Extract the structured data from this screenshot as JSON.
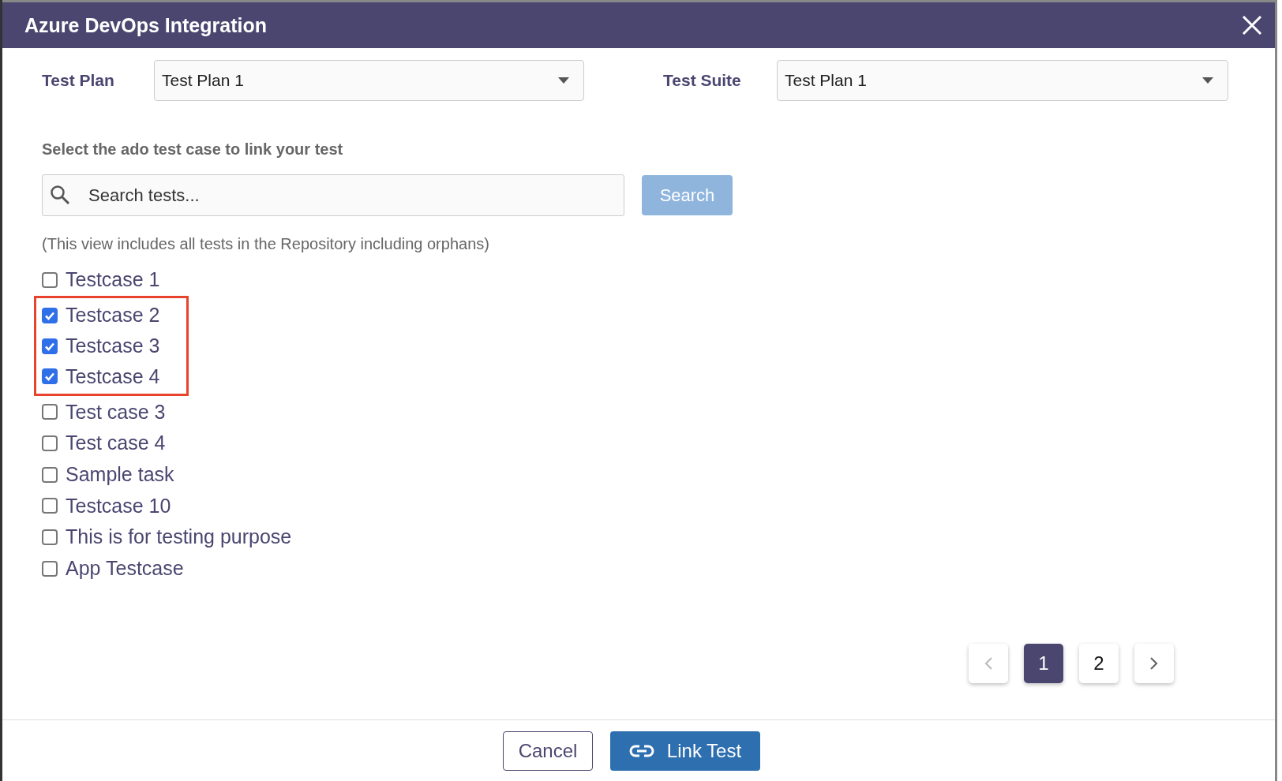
{
  "window": {
    "title": "Azure DevOps Integration"
  },
  "fields": [
    {
      "label": "Test Plan",
      "value": "Test Plan 1"
    },
    {
      "label": "Test Suite",
      "value": "Test Plan 1"
    }
  ],
  "section_title": "Select the ado test case to link your test",
  "search": {
    "placeholder": "Search tests...",
    "button": "Search",
    "disabled": true
  },
  "note": "(This view includes all tests in the Repository including orphans)",
  "test_cases": [
    {
      "label": "Testcase 1",
      "checked": false,
      "highlighted": false
    },
    {
      "label": "Testcase 2",
      "checked": true,
      "highlighted": true
    },
    {
      "label": "Testcase 3",
      "checked": true,
      "highlighted": true
    },
    {
      "label": "Testcase 4",
      "checked": true,
      "highlighted": true
    },
    {
      "label": "Test case 3",
      "checked": false,
      "highlighted": false
    },
    {
      "label": "Test case 4",
      "checked": false,
      "highlighted": false
    },
    {
      "label": "Sample task",
      "checked": false,
      "highlighted": false
    },
    {
      "label": "Testcase 10",
      "checked": false,
      "highlighted": false
    },
    {
      "label": "This is for testing purpose",
      "checked": false,
      "highlighted": false
    },
    {
      "label": "App Testcase",
      "checked": false,
      "highlighted": false
    }
  ],
  "pagination": {
    "prev_disabled": true,
    "pages": [
      {
        "label": "1",
        "selected": true
      },
      {
        "label": "2",
        "selected": false
      }
    ]
  },
  "buttons": {
    "cancel": "Cancel",
    "link": "Link Test"
  }
}
